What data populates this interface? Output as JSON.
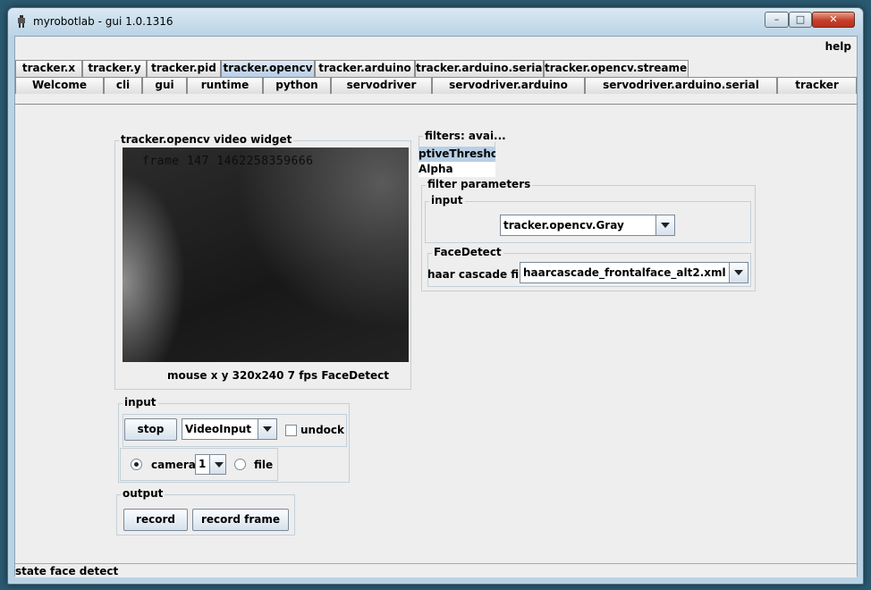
{
  "window": {
    "title": "myrobotlab - gui 1.0.1316",
    "minimize_glyph": "–",
    "maximize_glyph": "□",
    "close_glyph": "✕"
  },
  "menu": {
    "help": "help"
  },
  "tabs": {
    "row1": [
      "tracker.x",
      "tracker.y",
      "tracker.pid",
      "tracker.opencv",
      "tracker.arduino",
      "tracker.arduino.serial",
      "tracker.opencv.streamer"
    ],
    "row2": [
      "Welcome",
      "cli",
      "gui",
      "runtime",
      "python",
      "servodriver",
      "servodriver.arduino",
      "servodriver.arduino.serial",
      "tracker"
    ],
    "selected": "tracker.opencv"
  },
  "video_widget": {
    "title": "tracker.opencv  video widget",
    "frame_text": "frame 147 1462258359666",
    "status": "mouse x y  320x240  7 fps  FaceDetect"
  },
  "input": {
    "title": "input",
    "stop_label": "stop",
    "source_value": "VideoInput",
    "undock_label": "undock",
    "camera_label": "camera",
    "camera_index": "1",
    "file_label": "file"
  },
  "output": {
    "title": "output",
    "record_label": "record",
    "record_frame_label": "record frame"
  },
  "filters": {
    "title": "filters: avai...",
    "items": [
      "ptiveThreshold",
      "Alpha"
    ]
  },
  "filter_parameters": {
    "title": "filter parameters",
    "input_title": "input",
    "input_value": "tracker.opencv.Gray",
    "facedetect_title": "FaceDetect",
    "cascade_label": "haar cascade file",
    "cascade_value": "haarcascade_frontalface_alt2.xml"
  },
  "status": {
    "text": "state face detect"
  },
  "colors": {
    "desktop": "#2a5a70",
    "window_frame": "#b9d3e4",
    "panel": "#eeeeee",
    "selected_tab": "#b8cfe7",
    "close_button": "#c4402a"
  }
}
